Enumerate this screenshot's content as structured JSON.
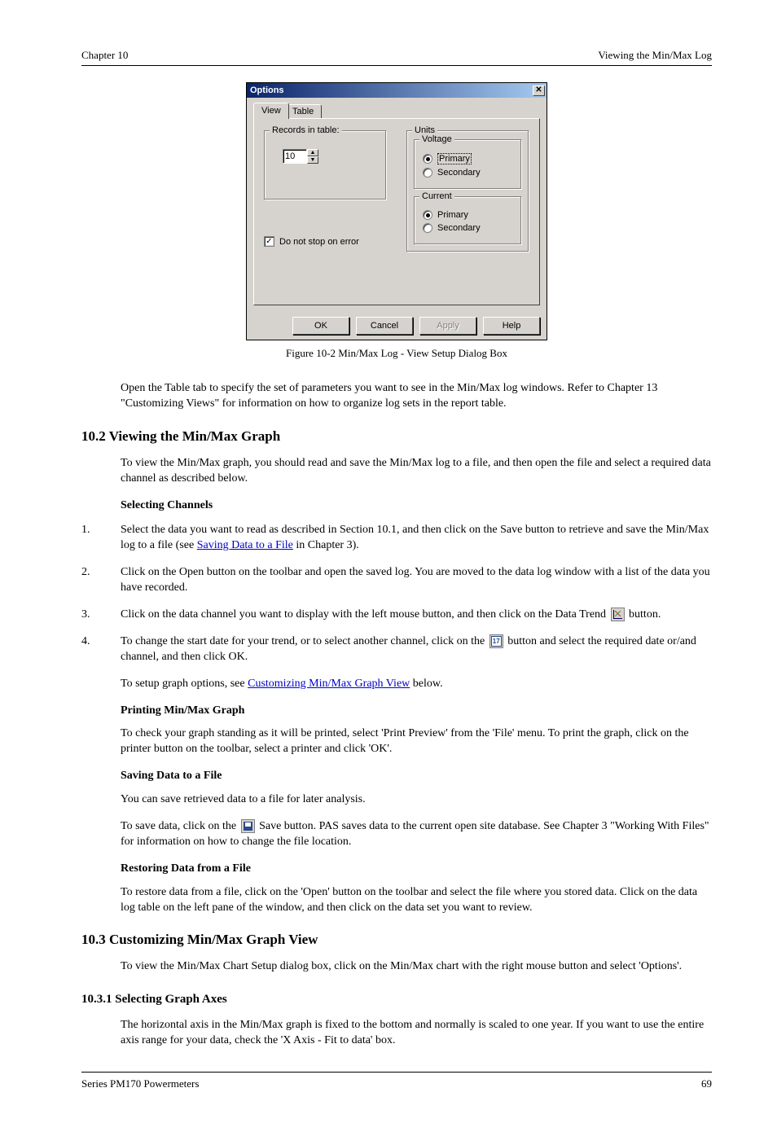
{
  "header": {
    "left": "Chapter 10",
    "right": "Viewing the Min/Max Log"
  },
  "dialog": {
    "title": "Options",
    "tabs": {
      "view": "View",
      "table": "Table"
    },
    "records_group": "Records in table:",
    "records_value": "10",
    "checkbox_label": "Do not stop on error",
    "units_group": "Units",
    "voltage_group": "Voltage",
    "current_group": "Current",
    "primary": "Primary",
    "secondary": "Secondary",
    "buttons": {
      "ok": "OK",
      "cancel": "Cancel",
      "apply": "Apply",
      "help": "Help"
    }
  },
  "figure_caption": "Figure 10-2  Min/Max Log - View Setup Dialog Box",
  "table_tab_text": "Open the Table tab to specify the set of parameters you want to see in the Min/Max log windows. Refer to Chapter 13 \"Customizing Views\" for information on how to organize log sets in the report table.",
  "sections": {
    "viewing_graph": {
      "title": "10.2 Viewing the Min/Max Graph",
      "intro": "To view the Min/Max graph, you should read and save the Min/Max log to a file, and then open the file and select a required data channel as described below.",
      "selecting_channels": "Selecting Channels",
      "step1a": "Select the data you want to read as described in Section 10.1, and then click on the Save button to retrieve and save the Min/Max log to a file (see ",
      "step1a_link": "Saving Data to a File",
      "step1a_tail": " in Chapter 3).",
      "step2_pre": "Click on the Open button on the toolbar and open the saved log. You are moved to the data log window with a list of the data you have recorded.",
      "step3": "Click on the data channel you want to display with the left mouse button, and then click on the Data Trend ",
      "step3_tail": " button.",
      "step4": "To change the start date for your trend, or to select another channel, click on the ",
      "step4_tail": " button and select the required date or/and channel, and then click OK.",
      "customize_text": "To setup graph options, see ",
      "customize_link": "Customizing Min/Max Graph View",
      "customize_tail": " below.",
      "printing_title": "Printing Min/Max Graph",
      "printing_text": "To check your graph standing as it will be printed, select 'Print Preview' from the 'File' menu. To print the graph, click on the printer button on the toolbar, select a printer and click 'OK'.",
      "saving_title": "Saving Data to a File",
      "saving_text_a": "You can save retrieved data to a file for later analysis.",
      "saving_text_b": "To save data, click on the ",
      "saving_text_b_tail": " Save button. PAS saves data to the current open site database. See Chapter 3 \"Working With Files\" for information on how to change the file location.",
      "restoring_title": "Restoring Data from a File",
      "restoring_text": "To restore data from a file, click on the 'Open' button on the toolbar and select the file where you stored data. Click on the data log table on the left pane of the window, and then click on the data set you want to review."
    },
    "customizing": {
      "title": "10.3 Customizing Min/Max Graph View",
      "intro": "To view the Min/Max Chart Setup dialog box, click on the Min/Max chart with the right mouse button and select 'Options'.",
      "axes_title": "10.3.1 Selecting Graph Axes",
      "axes_text": "The horizontal axis in the Min/Max graph is fixed to the bottom and normally is scaled to one year. If you want to use the entire axis range for your data, check the 'X Axis - Fit to data' box."
    }
  },
  "footer": {
    "left": "Series PM170 Powermeters",
    "right": "69"
  }
}
